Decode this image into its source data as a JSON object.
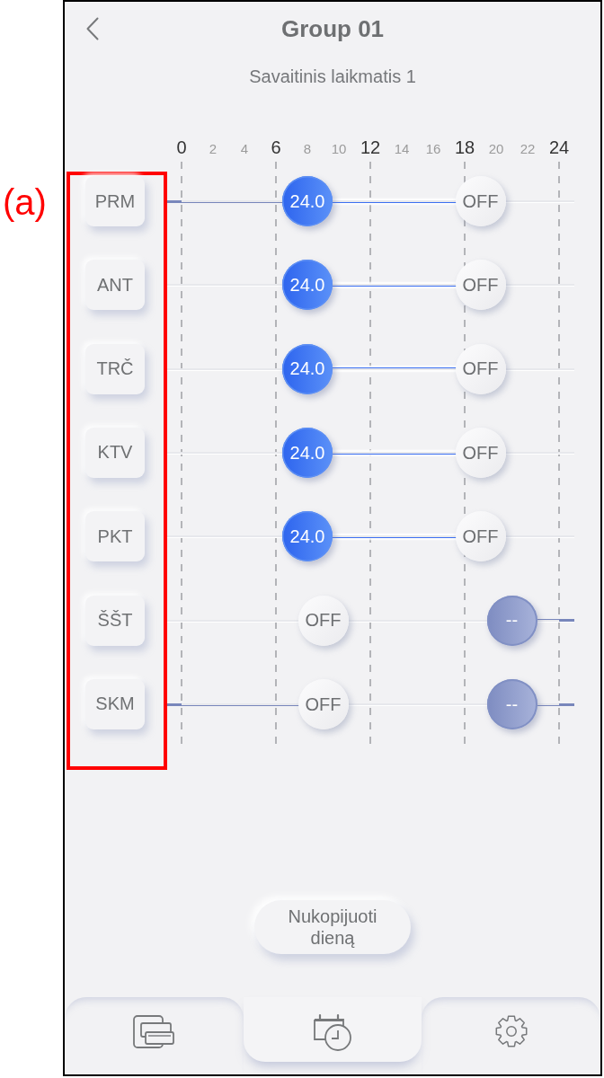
{
  "figure_label": "(a)",
  "header": {
    "title": "Group 01",
    "subtitle": "Savaitinis laikmatis 1"
  },
  "hours": [
    {
      "label": "0",
      "major": true
    },
    {
      "label": "2",
      "major": false
    },
    {
      "label": "4",
      "major": false
    },
    {
      "label": "6",
      "major": true
    },
    {
      "label": "8",
      "major": false
    },
    {
      "label": "10",
      "major": false
    },
    {
      "label": "12",
      "major": true
    },
    {
      "label": "14",
      "major": false
    },
    {
      "label": "16",
      "major": false
    },
    {
      "label": "18",
      "major": true
    },
    {
      "label": "20",
      "major": false
    },
    {
      "label": "22",
      "major": false
    },
    {
      "label": "24",
      "major": true
    }
  ],
  "days_highlighted": true,
  "days": [
    {
      "label": "PRM",
      "events": [
        {
          "kind": "setpoint",
          "label": "24.0",
          "level": 0.3333
        },
        {
          "kind": "off",
          "label": "OFF",
          "level": 0.7917
        }
      ]
    },
    {
      "label": "ANT",
      "events": [
        {
          "kind": "setpoint",
          "label": "24.0",
          "level": 0.3333
        },
        {
          "kind": "off",
          "label": "OFF",
          "level": 0.7917
        }
      ]
    },
    {
      "label": "TRČ",
      "events": [
        {
          "kind": "setpoint",
          "label": "24.0",
          "level": 0.3333
        },
        {
          "kind": "off",
          "label": "OFF",
          "level": 0.7917
        }
      ]
    },
    {
      "label": "KTV",
      "events": [
        {
          "kind": "setpoint",
          "label": "24.0",
          "level": 0.3333
        },
        {
          "kind": "off",
          "label": "OFF",
          "level": 0.7917
        }
      ]
    },
    {
      "label": "PKT",
      "events": [
        {
          "kind": "setpoint",
          "label": "24.0",
          "level": 0.3333
        },
        {
          "kind": "off",
          "label": "OFF",
          "level": 0.7917
        }
      ]
    },
    {
      "label": "ŠŠT",
      "events": [
        {
          "kind": "off",
          "label": "OFF",
          "level": 0.375
        },
        {
          "kind": "unset",
          "label": "--",
          "level": 0.875
        }
      ]
    },
    {
      "label": "SKM",
      "events": [
        {
          "kind": "off",
          "label": "OFF",
          "level": 0.375
        },
        {
          "kind": "unset",
          "label": "--",
          "level": 0.875
        }
      ]
    }
  ],
  "copy_button": {
    "label": "Nukopijuoti dieną"
  },
  "nav": [
    {
      "kind": "devices",
      "selected": false
    },
    {
      "kind": "schedule",
      "selected": true
    },
    {
      "kind": "settings",
      "selected": false
    }
  ]
}
